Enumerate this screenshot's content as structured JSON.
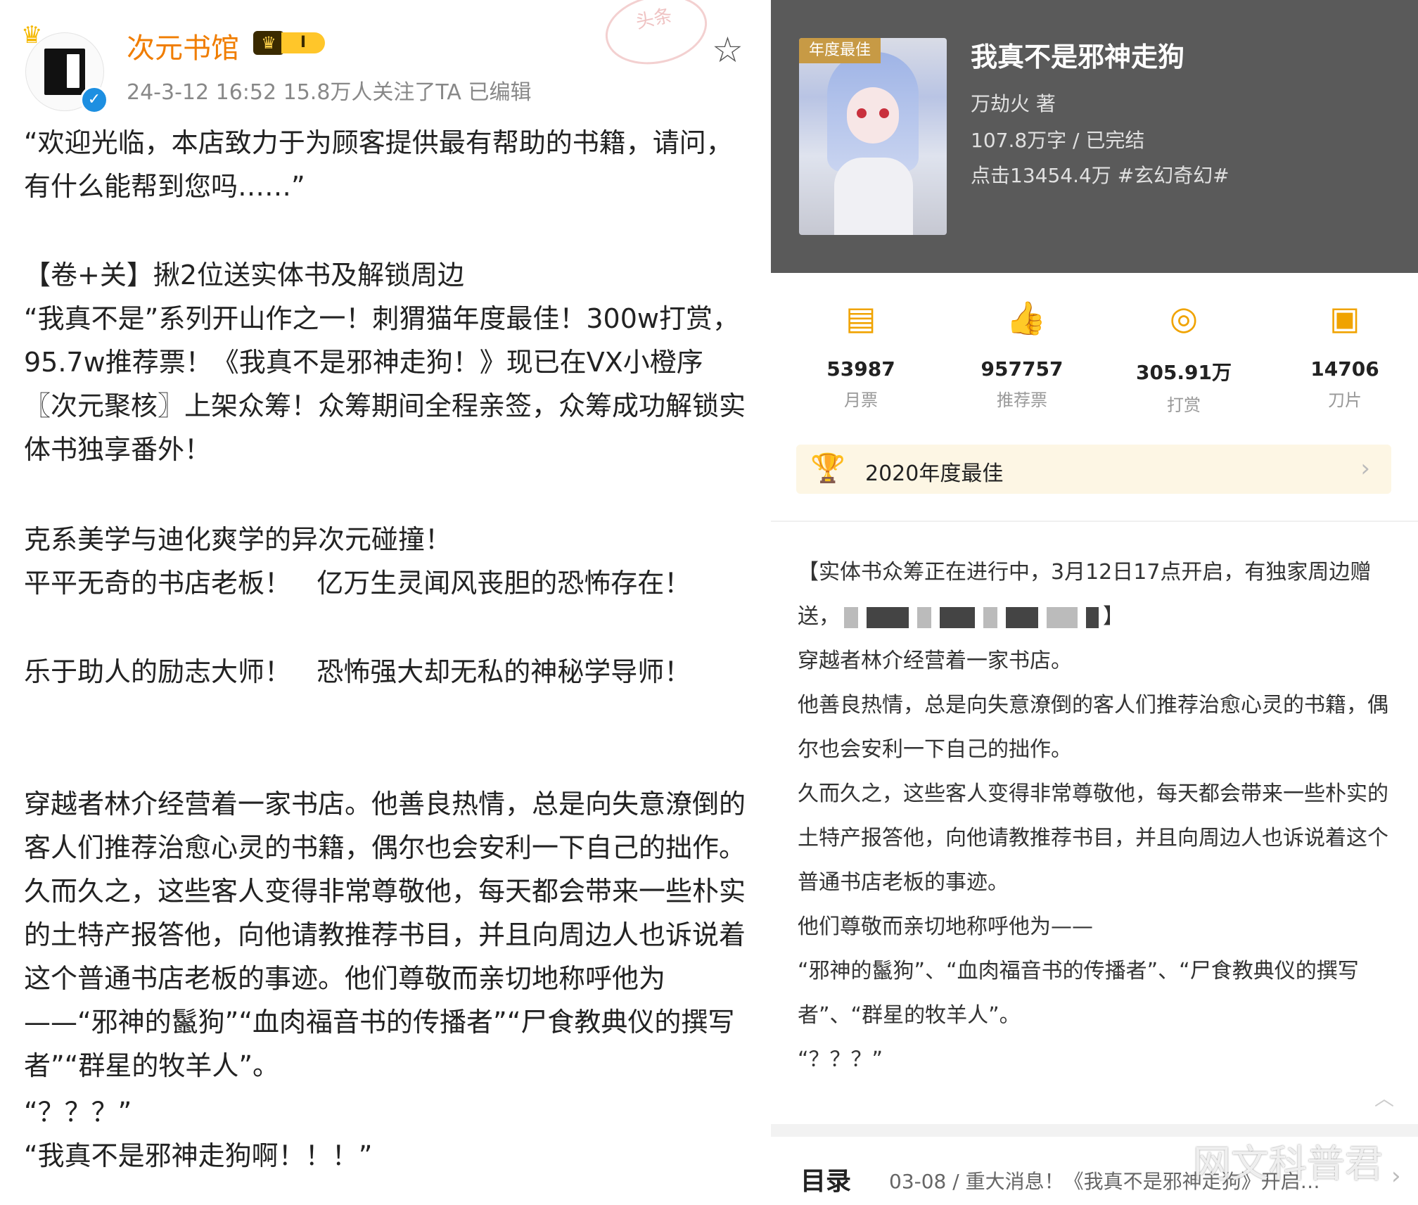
{
  "left": {
    "username": "次元书馆",
    "vip_level": "I",
    "meta": "24-3-12 16:52  15.8万人关注了TA  已编辑",
    "stamp": "头条",
    "paragraphs": [
      "“欢迎光临，本店致力于为顾客提供最有帮助的书籍，请问，有什么能帮到您吗……”",
      "【卷+关】揪2位送实体书及解锁周边",
      "“我真不是”系列开山作之一！刺猬猫年度最佳！300w打赏，95.7w推荐票！《我真不是邪神走狗！》现已在VX小橙序〖次元聚核〗上架众筹！众筹期间全程亲签，众筹成功解锁实体书独享番外！",
      "克系美学与迪化爽学的异次元碰撞！",
      "平平无奇的书店老板！   亿万生灵闻风丧胆的恐怖存在！",
      "乐于助人的励志大师！   恐怖强大却无私的神秘学导师！",
      "穿越者林介经营着一家书店。他善良热情，总是向失意潦倒的客人们推荐治愈心灵的书籍，偶尔也会安利一下自己的拙作。久而久之，这些客人变得非常尊敬他，每天都会带来一些朴实的土特产报答他，向他请教推荐书目，并且向周边人也诉说着这个普通书店老板的事迹。他们尊敬而亲切地称呼他为——“邪神的鬣狗”“血肉福音书的传播者”“尸食教典仪的撰写者”“群星的牧羊人”。",
      "“？？？”",
      "“我真不是邪神走狗啊！！！”"
    ]
  },
  "right": {
    "cover_tag": "年度最佳",
    "title": "我真不是邪神走狗",
    "author": "万劫火  著",
    "words": "107.8万字 / 已完结",
    "clicks": "点击13454.4万  #玄幻奇幻#",
    "stats": [
      {
        "icon": "monthly-ticket-icon",
        "value": "53987",
        "label": "月票"
      },
      {
        "icon": "thumbs-up-icon",
        "value": "957757",
        "label": "推荐票"
      },
      {
        "icon": "reward-coin-icon",
        "value": "305.91万",
        "label": "打赏"
      },
      {
        "icon": "blade-card-icon",
        "value": "14706",
        "label": "刀片"
      }
    ],
    "award": "2020年度最佳",
    "intro_lead": "【实体书众筹正在进行中，3月12日17点开启，有独家周边赠送，",
    "intro_lead_end": "】",
    "intro": [
      "穿越者林介经营着一家书店。",
      "他善良热情，总是向失意潦倒的客人们推荐治愈心灵的书籍，偶尔也会安利一下自己的拙作。",
      "久而久之，这些客人变得非常尊敬他，每天都会带来一些朴实的土特产报答他，向他请教推荐书目，并且向周边人也诉说着这个普通书店老板的事迹。",
      "他们尊敬而亲切地称呼他为——",
      "“邪神的鬣狗”、“血肉福音书的传播者”、“尸食教典仪的撰写者”、“群星的牧羊人”。",
      "“？？？”"
    ],
    "toc_label": "目录",
    "toc_latest": "03-08 / 重大消息！《我真不是邪神走狗》开启…",
    "watermark": "网文科普君"
  }
}
